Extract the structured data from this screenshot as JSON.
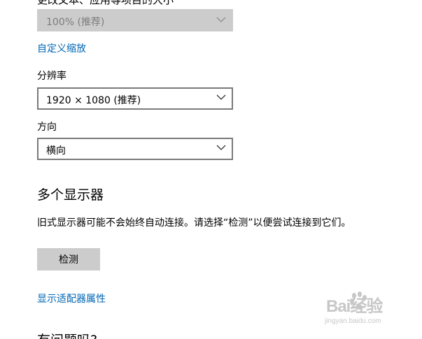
{
  "scale": {
    "cut_label": "更改文本、应用等项目的大小",
    "value": "100% (推荐)",
    "custom_link": "自定义缩放"
  },
  "resolution": {
    "label": "分辨率",
    "value": "1920 × 1080 (推荐)"
  },
  "orientation": {
    "label": "方向",
    "value": "横向"
  },
  "multiple_displays": {
    "title": "多个显示器",
    "description": "旧式显示器可能不会始终自动连接。请选择“检测”以便尝试连接到它们。",
    "detect_button": "检测",
    "adapter_link": "显示适配器属性"
  },
  "help": {
    "title": "有问题吗?"
  },
  "watermark": {
    "brand": "Bai经验",
    "url": "jingyan.baidu.com"
  },
  "colors": {
    "link": "#0066b4",
    "disabled_bg": "#cccccc",
    "border": "#7a7a7a"
  }
}
